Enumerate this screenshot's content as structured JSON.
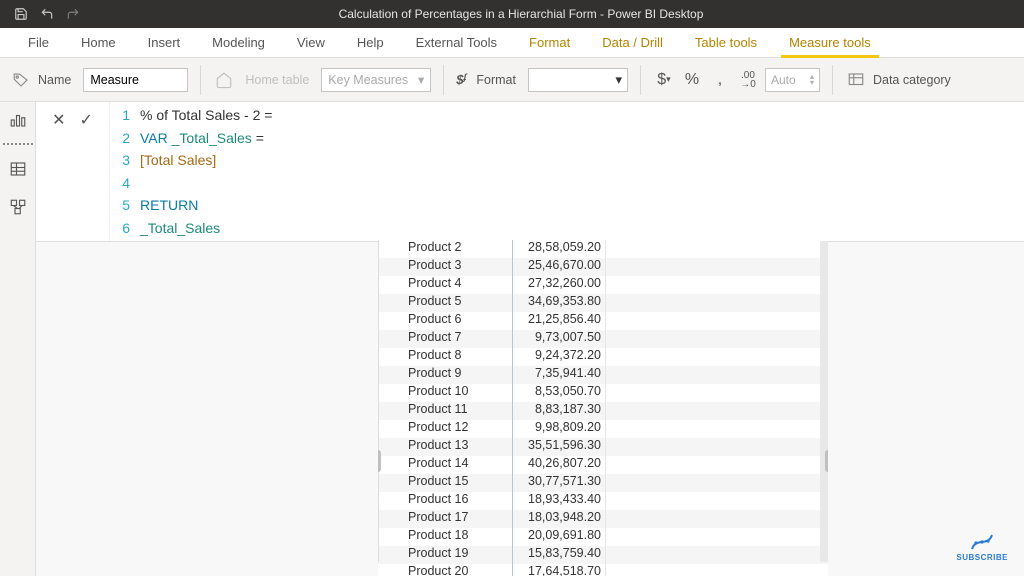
{
  "titlebar": {
    "title": "Calculation of Percentages in a Hierarchial Form - Power BI Desktop"
  },
  "tabs": {
    "file": "File",
    "home": "Home",
    "insert": "Insert",
    "modeling": "Modeling",
    "view": "View",
    "help": "Help",
    "external": "External Tools",
    "format": "Format",
    "datadrill": "Data / Drill",
    "tabletools": "Table tools",
    "measuretools": "Measure tools"
  },
  "ribbon": {
    "name_label": "Name",
    "name_value": "Measure",
    "home_table_label": "Home table",
    "key_measures": "Key Measures",
    "format_label": "Format",
    "auto": "Auto",
    "data_category": "Data category"
  },
  "formula": {
    "lines": [
      {
        "n": "1",
        "plain": "% of Total Sales - 2 ="
      },
      {
        "n": "2",
        "kw": "VAR",
        "var": " _Total_Sales ",
        "rest": "="
      },
      {
        "n": "3",
        "meas": "[Total Sales]"
      },
      {
        "n": "4",
        "plain": ""
      },
      {
        "n": "5",
        "kw": "RETURN"
      },
      {
        "n": "6",
        "var": "_Total_Sales"
      }
    ]
  },
  "table": {
    "rows": [
      {
        "name": "Product 2",
        "value": "28,58,059.20"
      },
      {
        "name": "Product 3",
        "value": "25,46,670.00"
      },
      {
        "name": "Product 4",
        "value": "27,32,260.00"
      },
      {
        "name": "Product 5",
        "value": "34,69,353.80"
      },
      {
        "name": "Product 6",
        "value": "21,25,856.40"
      },
      {
        "name": "Product 7",
        "value": "9,73,007.50"
      },
      {
        "name": "Product 8",
        "value": "9,24,372.20"
      },
      {
        "name": "Product 9",
        "value": "7,35,941.40"
      },
      {
        "name": "Product 10",
        "value": "8,53,050.70"
      },
      {
        "name": "Product 11",
        "value": "8,83,187.30"
      },
      {
        "name": "Product 12",
        "value": "9,98,809.20"
      },
      {
        "name": "Product 13",
        "value": "35,51,596.30"
      },
      {
        "name": "Product 14",
        "value": "40,26,807.20"
      },
      {
        "name": "Product 15",
        "value": "30,77,571.30"
      },
      {
        "name": "Product 16",
        "value": "18,93,433.40"
      },
      {
        "name": "Product 17",
        "value": "18,03,948.20"
      },
      {
        "name": "Product 18",
        "value": "20,09,691.80"
      },
      {
        "name": "Product 19",
        "value": "15,83,759.40"
      },
      {
        "name": "Product 20",
        "value": "17,64,518.70"
      }
    ]
  },
  "subscribe": "SUBSCRIBE"
}
